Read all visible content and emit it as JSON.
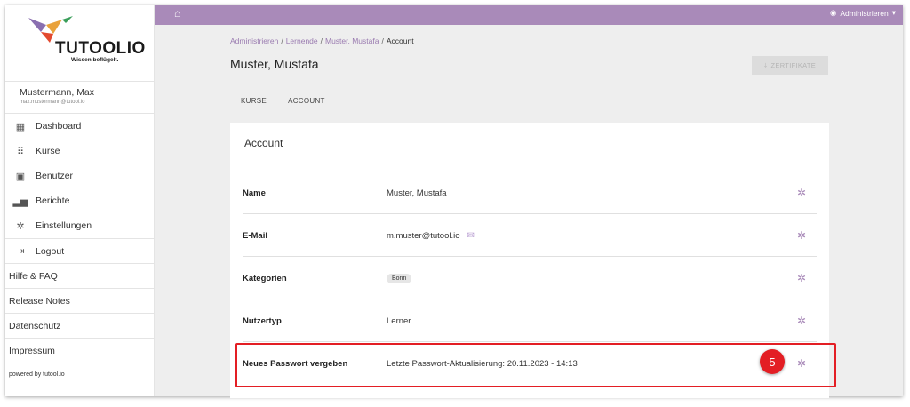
{
  "brand": {
    "name": "TUTOOLIO",
    "tagline": "Wissen beflügelt.",
    "accent": "#a98ab9"
  },
  "user": {
    "name": "Mustermann, Max",
    "email": "max.mustermann@tutool.io"
  },
  "nav": [
    {
      "label": "Dashboard",
      "icon": "dashboard-icon"
    },
    {
      "label": "Kurse",
      "icon": "grid-icon"
    },
    {
      "label": "Benutzer",
      "icon": "user-icon"
    },
    {
      "label": "Berichte",
      "icon": "bar-chart-icon"
    },
    {
      "label": "Einstellungen",
      "icon": "gear-icon"
    }
  ],
  "logout": {
    "label": "Logout",
    "icon": "logout-icon"
  },
  "links": [
    "Hilfe & FAQ",
    "Release Notes",
    "Datenschutz",
    "Impressum"
  ],
  "powered": "powered by tutool.io",
  "topbar": {
    "role": "Administrieren"
  },
  "breadcrumb": [
    "Administrieren",
    "Lernende",
    "Muster, Mustafa",
    "Account"
  ],
  "page": {
    "title": "Muster, Mustafa",
    "certificate_button": "ZERTIFIKATE"
  },
  "tabs": [
    "KURSE",
    "ACCOUNT"
  ],
  "card": {
    "title": "Account",
    "rows": [
      {
        "label": "Name",
        "value": "Muster, Mustafa"
      },
      {
        "label": "E-Mail",
        "value": "m.muster@tutool.io"
      },
      {
        "label": "Kategorien",
        "value": "Bonn"
      },
      {
        "label": "Nutzertyp",
        "value": "Lerner"
      },
      {
        "label": "Neues Passwort vergeben",
        "value": "Letzte Passwort-Aktualisierung: 20.11.2023 - 14:13"
      }
    ]
  },
  "annotation": {
    "number": "5",
    "color": "#e31e24"
  }
}
